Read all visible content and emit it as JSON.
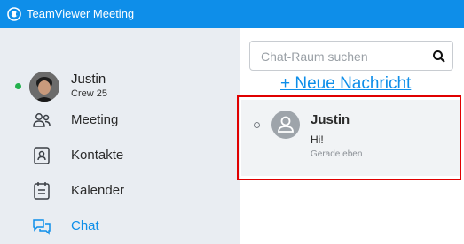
{
  "window": {
    "title": "TeamViewer Meeting",
    "icon": "teamviewer-logo-icon"
  },
  "user": {
    "name": "Justin",
    "subtitle": "Crew 25",
    "status_color": "#23b14d"
  },
  "nav": {
    "items": [
      {
        "label": "Meeting",
        "icon": "people-icon"
      },
      {
        "label": "Kontakte",
        "icon": "contact-card-icon"
      },
      {
        "label": "Kalender",
        "icon": "calendar-icon"
      },
      {
        "label": "Chat",
        "icon": "chat-bubbles-icon",
        "active": true
      }
    ]
  },
  "search": {
    "placeholder": "Chat-Raum suchen",
    "value": ""
  },
  "new_message_label": "+ Neue Nachricht",
  "chats": [
    {
      "name": "Justin",
      "message": "Hi!",
      "time": "Gerade eben"
    }
  ],
  "colors": {
    "accent": "#0e8ee9",
    "sidebar_bg": "#e9edf2",
    "highlight": "#e00000"
  }
}
